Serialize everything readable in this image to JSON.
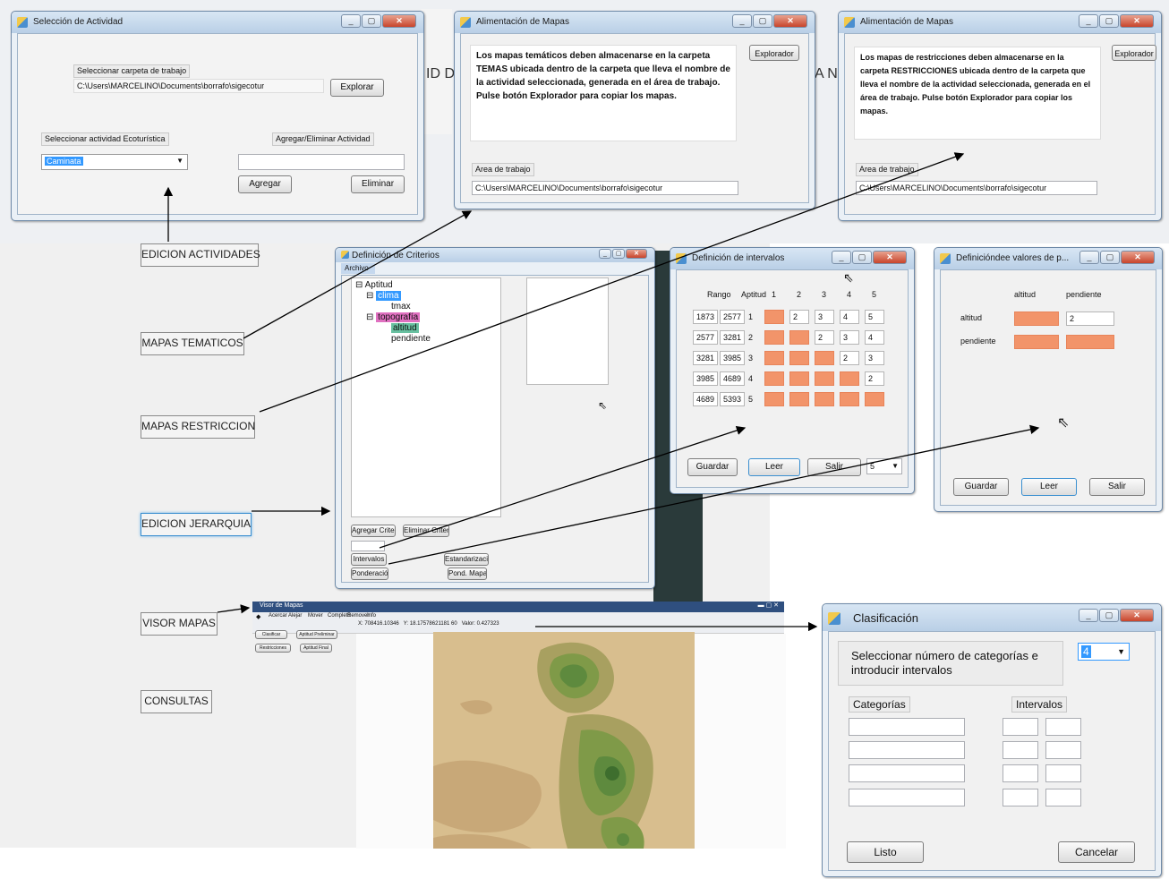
{
  "seleccion": {
    "title": "Selección de Actividad",
    "lbl_carpeta": "Seleccionar carpeta de trabajo",
    "path": "C:\\Users\\MARCELINO\\Documents\\borrafo\\sigecotur",
    "btn_explorar": "Explorar",
    "lbl_actividad": "Seleccionar actividad Ecoturística",
    "lbl_agregar_eliminar": "Agregar/Eliminar Actividad",
    "combo_value": "Caminata",
    "btn_agregar": "Agregar",
    "btn_eliminar": "Eliminar"
  },
  "tematicos": {
    "title": "Alimentación de Mapas",
    "text": "Los mapas temáticos deben almacenarse en la carpeta TEMAS ubicada dentro de la carpeta que lleva el nombre de la actividad seleccionada, generada en el área de trabajo. Pulse botón Explorador para copiar los mapas.",
    "btn_explorador": "Explorador",
    "lbl_area": "Area de trabajo",
    "path": "C:\\Users\\MARCELINO\\Documents\\borrafo\\sigecotur"
  },
  "restricciones": {
    "title": "Alimentación de Mapas",
    "text": "Los mapas de restricciones deben almacenarse en la carpeta RESTRICCIONES ubicada dentro de la carpeta que lleva el nombre de la actividad seleccionada, generada en el área de trabajo. Pulse botón Explorador para copiar los mapas.",
    "btn_explorador": "Explorador",
    "lbl_area": "Area de trabajo",
    "path": "C:\\Users\\MARCELINO\\Documents\\borrafo\\sigecotur"
  },
  "bg_fragments": {
    "left": "ID D",
    "right": "A N"
  },
  "side_buttons": {
    "edicion_actividades": "EDICION ACTIVIDADES",
    "mapas_tematicos": "MAPAS TEMATICOS",
    "mapas_restriccion": "MAPAS RESTRICCION",
    "edicion_jerarquia": "EDICION JERARQUIA",
    "visor_mapas": "VISOR MAPAS",
    "consultas": "CONSULTAS"
  },
  "criterios": {
    "title": "Definición de Criterios",
    "menu": "Archivo",
    "tree": {
      "root": "Aptitud",
      "clima": "clima",
      "tmax": "tmax",
      "topografia": "topografía",
      "altitud": "altitud",
      "pendiente": "pendiente"
    },
    "btn_agregar_criterio": "Agregar Criterio",
    "btn_eliminar_criterio": "Eliminar Criterio",
    "btn_intervalos": "Intervalos",
    "btn_estandarizacion": "Estandarización",
    "btn_ponderacion": "Ponderación",
    "btn_pond_mapas": "Pond. Mapas"
  },
  "intervalos": {
    "title": "Definición de intervalos",
    "h_rango": "Rango",
    "h_aptitud": "Aptitud",
    "cols": [
      "1",
      "2",
      "3",
      "4",
      "5"
    ],
    "rows": [
      {
        "r1": "1873",
        "r2": "2577",
        "apt": "1",
        "v": [
          "",
          "2",
          "3",
          "4",
          "5"
        ]
      },
      {
        "r1": "2577",
        "r2": "3281",
        "apt": "2",
        "v": [
          "",
          "",
          "2",
          "3",
          "4"
        ]
      },
      {
        "r1": "3281",
        "r2": "3985",
        "apt": "3",
        "v": [
          "",
          "",
          "",
          "2",
          "3"
        ]
      },
      {
        "r1": "3985",
        "r2": "4689",
        "apt": "4",
        "v": [
          "",
          "",
          "",
          "",
          "2"
        ]
      },
      {
        "r1": "4689",
        "r2": "5393",
        "apt": "5",
        "v": [
          "",
          "",
          "",
          "",
          ""
        ]
      }
    ],
    "btn_guardar": "Guardar",
    "btn_leer": "Leer",
    "btn_salir": "Salir",
    "combo": "5"
  },
  "valores": {
    "title": "Definicióndee valores de p...",
    "h_altitud": "altitud",
    "h_pendiente": "pendiente",
    "r_altitud": "altitud",
    "r_pendiente": "pendiente",
    "val": "2",
    "btn_guardar": "Guardar",
    "btn_leer": "Leer",
    "btn_salir": "Salir"
  },
  "visor": {
    "title": "Visor de Mapas",
    "menu": [
      "Acercar",
      "Alejar",
      "Mover",
      "Completo",
      "Remover",
      "Info"
    ],
    "x": "X: 708416.10346",
    "y": "Y: 18.17578621181 60",
    "valor": "Valor: 0.427323",
    "btns": [
      "Clasificar",
      "Aptitud Preliminar",
      "Restricciones",
      "Aptitud Final"
    ]
  },
  "clasificacion": {
    "title": "Clasificación",
    "prompt": "Seleccionar número de categorías e introducir intervalos",
    "combo": "4",
    "lbl_categorias": "Categorías",
    "lbl_intervalos": "Intervalos",
    "btn_listo": "Listo",
    "btn_cancelar": "Cancelar"
  },
  "colors": {
    "orange_cell": "#f2946a",
    "highlight_blue": "#3399ff",
    "topo_magenta": "#e070c0",
    "altitud_green": "#68c0a0",
    "map_land": "#d8be8e"
  }
}
